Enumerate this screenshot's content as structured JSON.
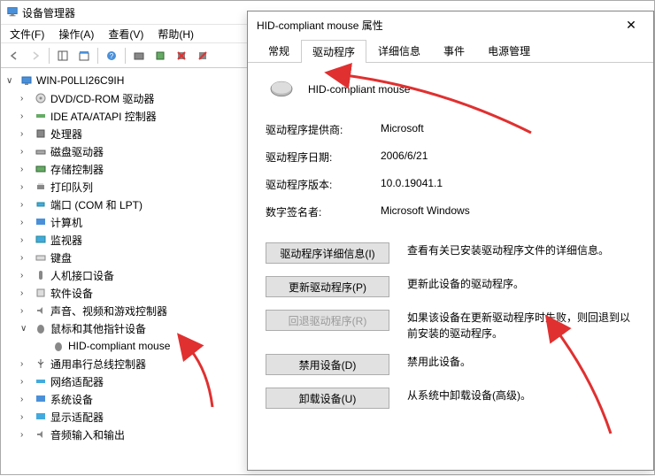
{
  "window": {
    "title": "设备管理器"
  },
  "menu": {
    "file": "文件(F)",
    "action": "操作(A)",
    "view": "查看(V)",
    "help": "帮助(H)"
  },
  "tree": {
    "root": "WIN-P0LLI26C9IH",
    "items": [
      "DVD/CD-ROM 驱动器",
      "IDE ATA/ATAPI 控制器",
      "处理器",
      "磁盘驱动器",
      "存储控制器",
      "打印队列",
      "端口 (COM 和 LPT)",
      "计算机",
      "监视器",
      "键盘",
      "人机接口设备",
      "软件设备",
      "声音、视频和游戏控制器",
      "鼠标和其他指针设备",
      "通用串行总线控制器",
      "网络适配器",
      "系统设备",
      "显示适配器",
      "音频输入和输出"
    ],
    "mouse_child": "HID-compliant mouse"
  },
  "dialog": {
    "title": "HID-compliant mouse 属性",
    "tabs": {
      "general": "常规",
      "driver": "驱动程序",
      "details": "详细信息",
      "events": "事件",
      "power": "电源管理"
    },
    "device_name": "HID-compliant mouse",
    "info": {
      "provider_k": "驱动程序提供商:",
      "provider_v": "Microsoft",
      "date_k": "驱动程序日期:",
      "date_v": "2006/6/21",
      "version_k": "驱动程序版本:",
      "version_v": "10.0.19041.1",
      "signer_k": "数字签名者:",
      "signer_v": "Microsoft Windows"
    },
    "actions": {
      "details_btn": "驱动程序详细信息(I)",
      "details_desc": "查看有关已安装驱动程序文件的详细信息。",
      "update_btn": "更新驱动程序(P)",
      "update_desc": "更新此设备的驱动程序。",
      "rollback_btn": "回退驱动程序(R)",
      "rollback_desc": "如果该设备在更新驱动程序时失败，则回退到以前安装的驱动程序。",
      "disable_btn": "禁用设备(D)",
      "disable_desc": "禁用此设备。",
      "uninstall_btn": "卸载设备(U)",
      "uninstall_desc": "从系统中卸载设备(高级)。"
    }
  }
}
